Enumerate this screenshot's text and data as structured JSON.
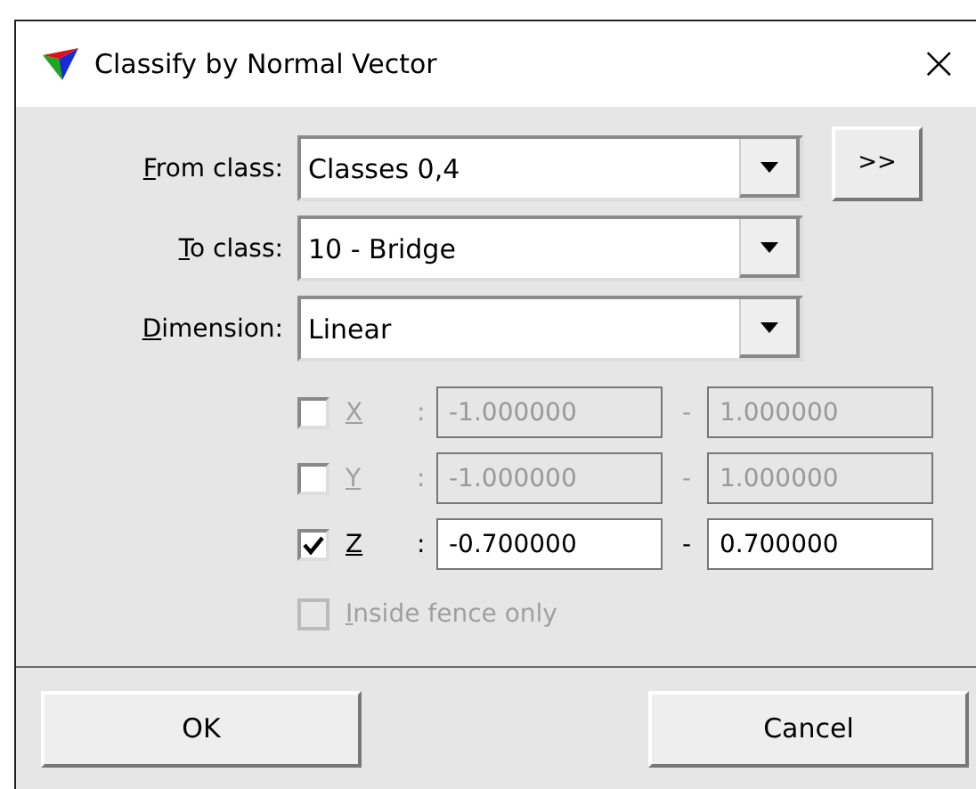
{
  "window": {
    "title": "Classify by Normal Vector",
    "close": "×"
  },
  "combos": [
    {
      "label": "From class:",
      "value": "Classes 0,4"
    },
    {
      "label": "To class:",
      "value": "10 - Bridge"
    },
    {
      "label": "Dimension:",
      "value": "Linear"
    }
  ],
  "more_button": ">>",
  "ranges": [
    {
      "label": "X",
      "checked": false,
      "colon": ":",
      "min": "-1.000000",
      "dash": "-",
      "max": "1.000000"
    },
    {
      "label": "Y",
      "checked": false,
      "colon": ":",
      "min": "-1.000000",
      "dash": "-",
      "max": "1.000000"
    },
    {
      "label": "Z",
      "checked": true,
      "colon": ":",
      "min": "-0.700000",
      "dash": "-",
      "max": "0.700000"
    }
  ],
  "inside_fence": {
    "label": "Inside fence only",
    "checked": false,
    "disabled": true
  },
  "buttons": [
    "OK",
    "Cancel"
  ]
}
